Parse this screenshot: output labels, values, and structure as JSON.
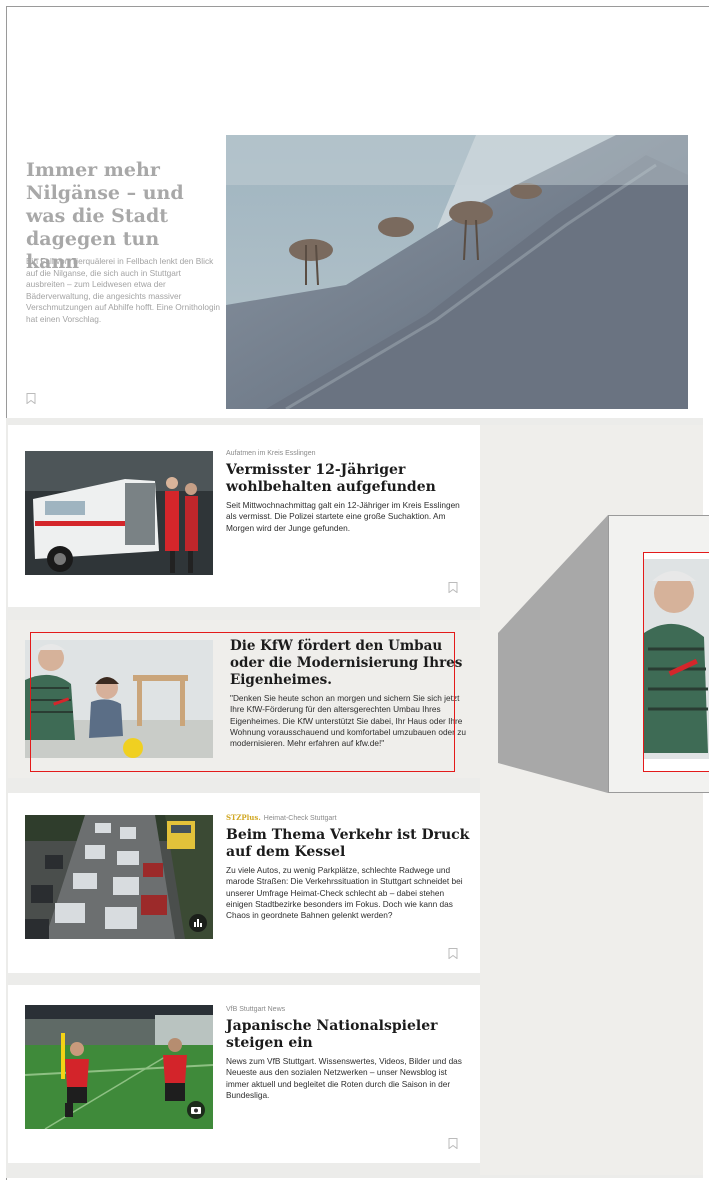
{
  "hero": {
    "title": "Immer mehr Nilgänse – und was die Stadt dagegen tun kann",
    "text": "Ein Fall von Tierquälerei in Fellbach lenkt den Blick auf die Nilganse, die sich auch in Stuttgart ausbreiten – zum Leidwesen etwa der Bäderverwaltung, die angesichts massiver Verschmutzungen auf Abhilfe hofft. Eine Ornithologin hat einen Vorschlag."
  },
  "articles": [
    {
      "kicker": "Aufatmen im Kreis Esslingen",
      "title": "Vermisster 12-Jähriger wohlbehalten aufgefunden",
      "text": "Seit Mittwochnachmittag galt ein 12-Jähriger im Kreis Esslingen als vermisst. Die Polizei startete eine große Suchaktion. Am Morgen wird der Junge gefunden."
    },
    {
      "title": "Die KfW fördert den Umbau oder die Modernisierung Ihres Eigenheimes.",
      "text": "\"Denken Sie heute schon an morgen und sichern Sie sich jetzt Ihre KfW-Förderung für den altersgerechten Umbau Ihres Eigenheimes. Die KfW unterstützt Sie dabei, Ihr Haus oder Ihre Wohnung vorausschauend und komfortabel umzubauen oder zu modernisieren. Mehr erfahren auf kfw.de!\""
    },
    {
      "brand": "STZPlus.",
      "kicker": "Heimat-Check Stuttgart",
      "title": "Beim Thema Verkehr ist Druck auf dem Kessel",
      "text": "Zu viele Autos, zu wenig Parkplätze, schlechte Radwege und marode Straßen: Die Verkehrssituation in Stuttgart schneidet bei unserer Umfrage Heimat-Check schlecht ab – dabei stehen einigen Stadtbezirke besonders im Fokus. Doch wie kann das Chaos in geordnete Bahnen gelenkt werden?"
    },
    {
      "kicker": "VfB Stuttgart News",
      "title": "Japanische Nationalspieler steigen ein",
      "text": "News zum VfB Stuttgart. Wissenswertes, Videos, Bilder und das Neueste aus den sozialen Netzwerken – unser Newsblog ist immer aktuell und begleitet die Roten durch die Saison in der Bundesliga."
    }
  ],
  "colors": {
    "highlight": "#e31a1a",
    "plus": "#d1a824"
  }
}
